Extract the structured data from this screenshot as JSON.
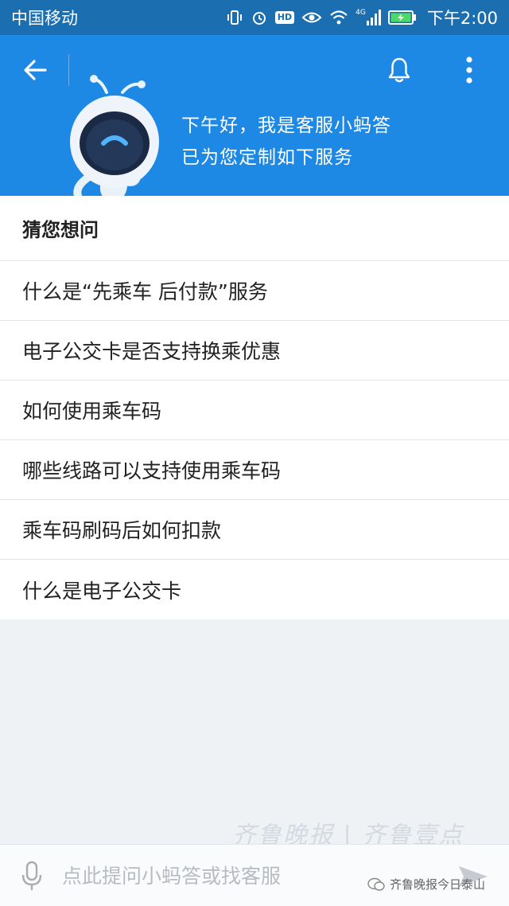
{
  "status_bar": {
    "carrier": "中国移动",
    "hd": "HD",
    "network": "4G",
    "time": "下午2:00"
  },
  "header": {
    "greeting_line1": "下午好，我是客服小蚂答",
    "greeting_line2": "已为您定制如下服务",
    "accent_color": "#1e88e5"
  },
  "questions": {
    "title": "猜您想问",
    "items": [
      {
        "label": "什么是“先乘车 后付款”服务"
      },
      {
        "label": "电子公交卡是否支持换乘优惠"
      },
      {
        "label": "如何使用乘车码"
      },
      {
        "label": "哪些线路可以支持使用乘车码"
      },
      {
        "label": "乘车码刷码后如何扣款"
      },
      {
        "label": "什么是电子公交卡"
      }
    ]
  },
  "input": {
    "placeholder": "点此提问小蚂答或找客服"
  },
  "overlay": {
    "watermark": "齐鲁晚报 | 齐鲁壹点",
    "source": "齐鲁晚报今日泰山"
  },
  "icons": [
    "back-arrow-icon",
    "bell-icon",
    "more-vertical-icon",
    "mic-icon",
    "send-icon"
  ]
}
